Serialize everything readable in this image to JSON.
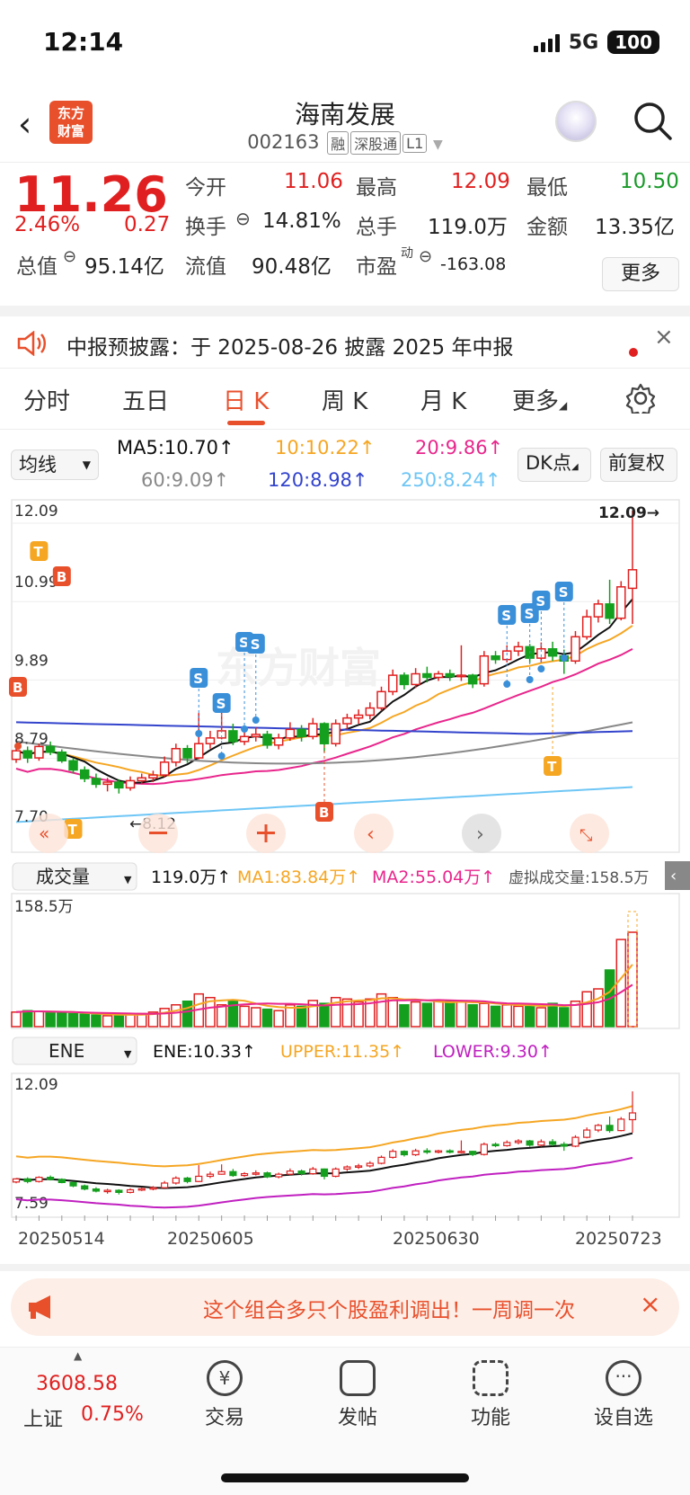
{
  "status_bar": {
    "time": "12:14",
    "network": "5G",
    "battery": "100"
  },
  "header": {
    "logo_line1": "东方",
    "logo_line2": "财富",
    "title": "海南发展",
    "code": "002163",
    "tags": [
      "融",
      "深股通",
      "L1"
    ]
  },
  "quote": {
    "price": "11.26",
    "change_pct": "2.46%",
    "change": "0.27",
    "open_label": "今开",
    "open": "11.06",
    "high_label": "最高",
    "high": "12.09",
    "low_label": "最低",
    "low": "10.50",
    "turnover_label": "换手",
    "turnover": "14.81%",
    "volume_label": "总手",
    "volume": "119.0万",
    "amount_label": "金额",
    "amount": "13.35亿",
    "mktcap_label": "总值",
    "mktcap": "95.14亿",
    "float_label": "流值",
    "float": "90.48亿",
    "pe_label": "市盈",
    "pe_sup": "动",
    "pe": "-163.08",
    "more_label": "更多"
  },
  "notice": {
    "text": "中报预披露：于 2025-08-26 披露 2025 年中报",
    "close": "×"
  },
  "tabs": [
    "分时",
    "五日",
    "日 K",
    "周 K",
    "月 K",
    "更多"
  ],
  "ma_row": {
    "select": "均线",
    "ma5": "MA5:10.70↑",
    "ma10": "10:10.22↑",
    "ma20": "20:9.86↑",
    "ma60": "60:9.09↑",
    "ma120": "120:8.98↑",
    "ma250": "250:8.24↑",
    "dk_button": "DK点",
    "fq_button": "前复权"
  },
  "colors": {
    "up": "#e02020",
    "down": "#14a01e",
    "ma5": "#111111",
    "ma10": "#f5a623",
    "ma20": "#e8268c",
    "ma60": "#888888",
    "ma120": "#3344cc",
    "ma250": "#6ec6f5",
    "accent": "#e8502c"
  },
  "kline": {
    "y_labels": [
      "12.09",
      "10.99",
      "9.89",
      "8.79",
      "7.70"
    ],
    "high_mark": "12.09→",
    "low_mark": "←8.12",
    "candles": [
      [
        8.6,
        8.72,
        8.75,
        8.55
      ],
      [
        8.72,
        8.62,
        8.78,
        8.55
      ],
      [
        8.62,
        8.78,
        8.82,
        8.58
      ],
      [
        8.78,
        8.7,
        8.85,
        8.66
      ],
      [
        8.7,
        8.58,
        8.74,
        8.55
      ],
      [
        8.58,
        8.45,
        8.62,
        8.4
      ],
      [
        8.45,
        8.33,
        8.5,
        8.28
      ],
      [
        8.33,
        8.25,
        8.4,
        8.2
      ],
      [
        8.25,
        8.28,
        8.34,
        8.15
      ],
      [
        8.28,
        8.2,
        8.32,
        8.12
      ],
      [
        8.2,
        8.3,
        8.36,
        8.16
      ],
      [
        8.3,
        8.34,
        8.4,
        8.25
      ],
      [
        8.34,
        8.38,
        8.44,
        8.28
      ],
      [
        8.38,
        8.56,
        8.64,
        8.35
      ],
      [
        8.56,
        8.75,
        8.82,
        8.5
      ],
      [
        8.75,
        8.62,
        8.8,
        8.55
      ],
      [
        8.62,
        8.82,
        9.25,
        8.6
      ],
      [
        8.82,
        8.9,
        9.0,
        8.75
      ],
      [
        8.9,
        9.0,
        9.28,
        8.88
      ],
      [
        9.0,
        8.85,
        9.1,
        8.8
      ],
      [
        8.85,
        8.92,
        8.98,
        8.8
      ],
      [
        8.92,
        8.95,
        9.05,
        8.85
      ],
      [
        8.95,
        8.8,
        9.0,
        8.75
      ],
      [
        8.8,
        8.9,
        8.96,
        8.74
      ],
      [
        8.9,
        9.02,
        9.12,
        8.86
      ],
      [
        9.02,
        8.92,
        9.08,
        8.85
      ],
      [
        8.92,
        9.1,
        9.18,
        8.88
      ],
      [
        9.1,
        8.82,
        9.12,
        8.7
      ],
      [
        8.82,
        9.1,
        9.16,
        8.78
      ],
      [
        9.1,
        9.18,
        9.24,
        9.02
      ],
      [
        9.18,
        9.22,
        9.3,
        9.1
      ],
      [
        9.22,
        9.32,
        9.4,
        9.16
      ],
      [
        9.32,
        9.55,
        9.62,
        9.28
      ],
      [
        9.55,
        9.78,
        9.86,
        9.5
      ],
      [
        9.78,
        9.65,
        9.82,
        9.58
      ],
      [
        9.65,
        9.8,
        9.88,
        9.6
      ],
      [
        9.8,
        9.75,
        9.9,
        9.68
      ],
      [
        9.75,
        9.8,
        9.84,
        9.7
      ],
      [
        9.8,
        9.76,
        9.86,
        9.7
      ],
      [
        9.76,
        9.78,
        10.2,
        9.7
      ],
      [
        9.78,
        9.66,
        9.8,
        9.6
      ],
      [
        9.66,
        10.05,
        10.12,
        9.62
      ],
      [
        10.05,
        10.0,
        10.12,
        9.94
      ],
      [
        10.0,
        10.12,
        10.2,
        9.96
      ],
      [
        10.12,
        10.18,
        10.25,
        10.05
      ],
      [
        10.18,
        10.02,
        10.22,
        9.95
      ],
      [
        10.02,
        10.15,
        10.24,
        9.96
      ],
      [
        10.15,
        10.05,
        10.25,
        9.98
      ],
      [
        10.05,
        9.98,
        10.14,
        9.8
      ],
      [
        9.98,
        10.32,
        10.4,
        9.94
      ],
      [
        10.32,
        10.6,
        10.7,
        10.28
      ],
      [
        10.6,
        10.78,
        10.84,
        10.52
      ],
      [
        10.78,
        10.58,
        11.12,
        10.5
      ],
      [
        10.58,
        11.02,
        11.1,
        10.55
      ],
      [
        11.0,
        11.26,
        12.09,
        10.5
      ]
    ]
  },
  "volume": {
    "select": "成交量",
    "value": "119.0万↑",
    "ma1": "MA1:83.84万↑",
    "ma2": "MA2:55.04万↑",
    "virtual": "虚拟成交量:158.5万",
    "y_label": "158.5万",
    "bars": [
      20,
      22,
      21,
      20,
      19,
      18,
      17,
      16,
      15,
      16,
      17,
      18,
      20,
      25,
      30,
      35,
      45,
      40,
      30,
      35,
      28,
      26,
      24,
      22,
      30,
      28,
      36,
      32,
      40,
      38,
      34,
      38,
      45,
      40,
      30,
      34,
      32,
      36,
      35,
      34,
      30,
      32,
      28,
      30,
      28,
      30,
      26,
      32,
      26,
      35,
      48,
      52,
      78,
      120,
      130
    ]
  },
  "ene": {
    "select": "ENE",
    "value": "ENE:10.33↑",
    "upper": "UPPER:11.35↑",
    "lower": "LOWER:9.30↑",
    "y_top": "12.09",
    "y_bottom": "7.59",
    "dates": [
      "20250514",
      "20250605",
      "20250630",
      "20250723"
    ]
  },
  "ad": {
    "text": "这个组合多只个股盈利调出！一周调一次",
    "close": "×"
  },
  "tabbar": {
    "index_value": "3608.58",
    "index_name": "上证",
    "index_pct": "0.75%",
    "items": [
      "交易",
      "发帖",
      "功能",
      "设自选"
    ]
  }
}
